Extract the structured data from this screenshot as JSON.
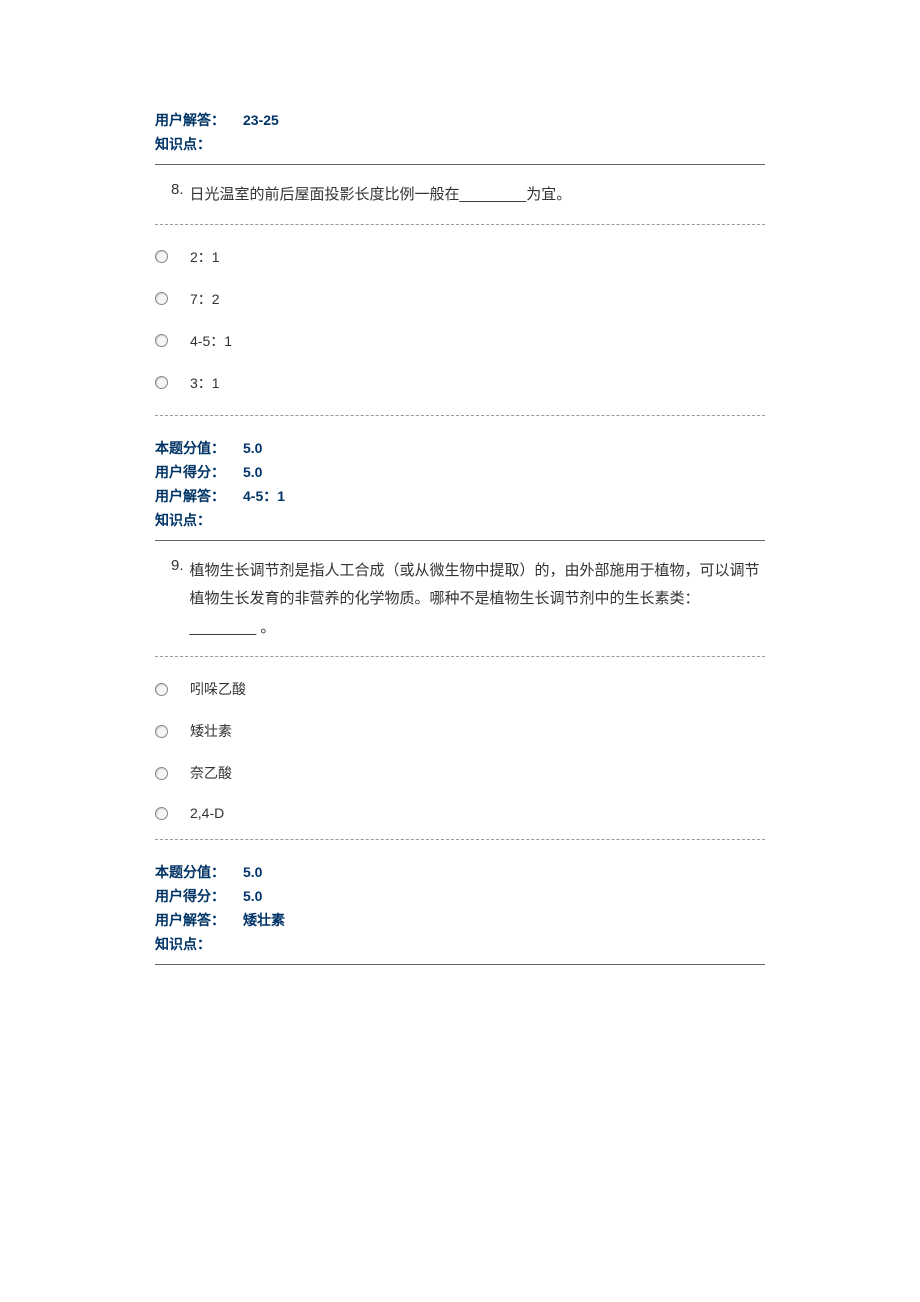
{
  "labels": {
    "user_answer": "用户解答：",
    "knowledge_point": "知识点：",
    "question_score": "本题分值：",
    "user_score": "用户得分："
  },
  "q7_tail": {
    "user_answer": "23-25"
  },
  "q8": {
    "number": "8.",
    "text": "日光温室的前后屋面投影长度比例一般在________为宜。",
    "options": [
      "2：1",
      "7：2",
      "4-5：1",
      "3：1"
    ],
    "score": "5.0",
    "user_score": "5.0",
    "user_answer": "4-5：1"
  },
  "q9": {
    "number": "9.",
    "text": "植物生长调节剂是指人工合成（或从微生物中提取）的，由外部施用于植物，可以调节植物生长发育的非营养的化学物质。哪种不是植物生长调节剂中的生长素类：________ 。",
    "options": [
      "吲哚乙酸",
      "矮壮素",
      "奈乙酸",
      "2,4-D"
    ],
    "score": "5.0",
    "user_score": "5.0",
    "user_answer": "矮壮素"
  }
}
